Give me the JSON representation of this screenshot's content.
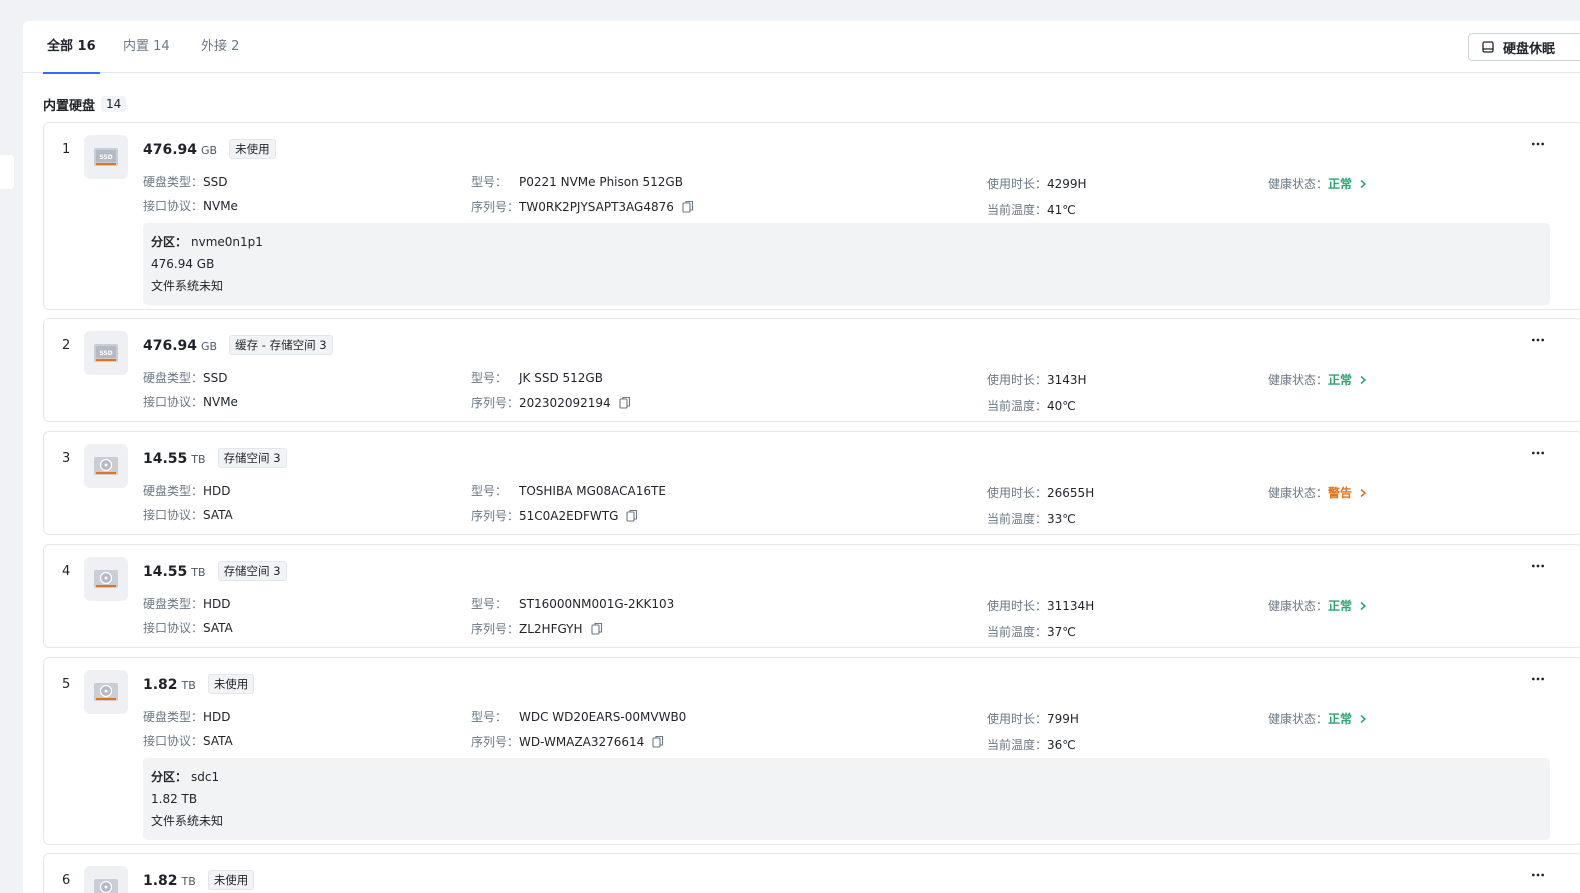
{
  "tabs": [
    {
      "label": "全部 16",
      "active": true
    },
    {
      "label": "内置 14",
      "active": false
    },
    {
      "label": "外接 2",
      "active": false
    }
  ],
  "sleep_button": {
    "label": "硬盘休眠",
    "icon": "disk-sleep-icon"
  },
  "section": {
    "title": "内置硬盘",
    "count": "14"
  },
  "labels": {
    "type": "硬盘类型：",
    "protocol": "接口协议：",
    "model": "型号：",
    "serial": "序列号：",
    "runtime": "使用时长：",
    "temp": "当前温度：",
    "health": "健康状态：",
    "partition": "分区："
  },
  "colors": {
    "accent": "#2f6bff",
    "ok": "#2ba471",
    "warn": "#e37318"
  },
  "disks": [
    {
      "index": "1",
      "icon": "ssd-icon",
      "capacity": "476.94",
      "unit": "GB",
      "usage": "未使用",
      "type": "SSD",
      "protocol": "NVMe",
      "model": "P0221 NVMe Phison 512GB",
      "serial": "TW0RK2PJYSAPT3AG4876",
      "runtime": "4299H",
      "temp": "41℃",
      "health": "正常",
      "health_status": "ok",
      "partition": {
        "name": "nvme0n1p1",
        "size": "476.94 GB",
        "fs": "文件系统未知"
      }
    },
    {
      "index": "2",
      "icon": "ssd-icon",
      "capacity": "476.94",
      "unit": "GB",
      "usage": "缓存 - 存储空间 3",
      "type": "SSD",
      "protocol": "NVMe",
      "model": "JK SSD 512GB",
      "serial": "202302092194",
      "runtime": "3143H",
      "temp": "40℃",
      "health": "正常",
      "health_status": "ok"
    },
    {
      "index": "3",
      "icon": "hdd-icon",
      "capacity": "14.55",
      "unit": "TB",
      "usage": "存储空间 3",
      "type": "HDD",
      "protocol": "SATA",
      "model": "TOSHIBA MG08ACA16TE",
      "serial": "51C0A2EDFWTG",
      "runtime": "26655H",
      "temp": "33℃",
      "health": "警告",
      "health_status": "warn"
    },
    {
      "index": "4",
      "icon": "hdd-icon",
      "capacity": "14.55",
      "unit": "TB",
      "usage": "存储空间 3",
      "type": "HDD",
      "protocol": "SATA",
      "model": "ST16000NM001G-2KK103",
      "serial": "ZL2HFGYH",
      "runtime": "31134H",
      "temp": "37℃",
      "health": "正常",
      "health_status": "ok"
    },
    {
      "index": "5",
      "icon": "hdd-icon",
      "capacity": "1.82",
      "unit": "TB",
      "usage": "未使用",
      "type": "HDD",
      "protocol": "SATA",
      "model": "WDC WD20EARS-00MVWB0",
      "serial": "WD-WMAZA3276614",
      "runtime": "799H",
      "temp": "36℃",
      "health": "正常",
      "health_status": "ok",
      "partition": {
        "name": "sdc1",
        "size": "1.82 TB",
        "fs": "文件系统未知"
      }
    },
    {
      "index": "6",
      "icon": "hdd-icon",
      "capacity": "1.82",
      "unit": "TB",
      "usage": "未使用"
    }
  ]
}
